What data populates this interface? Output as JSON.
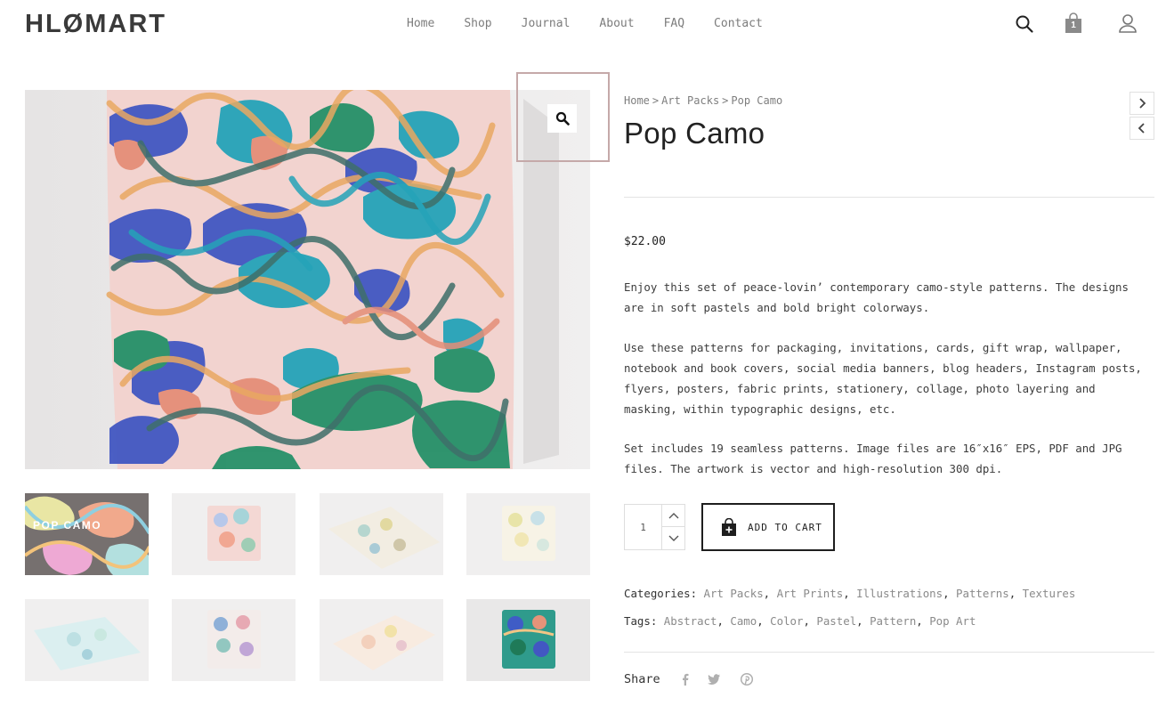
{
  "brand": {
    "logo": "HLØMART"
  },
  "nav": [
    "Home",
    "Shop",
    "Journal",
    "About",
    "FAQ",
    "Contact"
  ],
  "header_icons": {
    "search": "search-icon",
    "cart": "shopping-bag-icon",
    "account": "user-icon",
    "cart_count": "1"
  },
  "gallery": {
    "zoom_icon": "magnifier-icon",
    "first_thumb_caption": "POP CAMO"
  },
  "breadcrumb": [
    "Home",
    "Art Packs",
    "Pop Camo"
  ],
  "breadcrumb_sep": ">",
  "product": {
    "title": "Pop Camo",
    "price": "$22.00",
    "description": [
      "Enjoy this set of peace-lovin’ contemporary camo-style patterns. The designs are in soft pastels and bold bright colorways.",
      "Use these patterns for packaging, invitations, cards, gift wrap, wallpaper, notebook and book covers, social media banners, blog headers, Instagram posts, flyers, posters, fabric prints, stationery, collage, photo layering and masking, within typographic designs, etc.",
      "Set includes 19 seamless patterns. Image files are 16″x16″ EPS, PDF and JPG files. The artwork is vector and high-resolution 300 dpi."
    ],
    "quantity": "1",
    "add_to_cart": "ADD TO CART"
  },
  "meta": {
    "categories_label": "Categories:",
    "categories": [
      "Art Packs",
      "Art Prints",
      "Illustrations",
      "Patterns",
      "Textures"
    ],
    "tags_label": "Tags:",
    "tags": [
      "Abstract",
      "Camo",
      "Color",
      "Pastel",
      "Pattern",
      "Pop Art"
    ]
  },
  "share": {
    "label": "Share",
    "icons": [
      "facebook-icon",
      "twitter-icon",
      "pinterest-icon"
    ]
  },
  "colors": {
    "text": "#2b2b2b",
    "muted": "#8a8a8a",
    "zoom_frame": "#c5a9a9",
    "button_border": "#1e1e1e"
  }
}
